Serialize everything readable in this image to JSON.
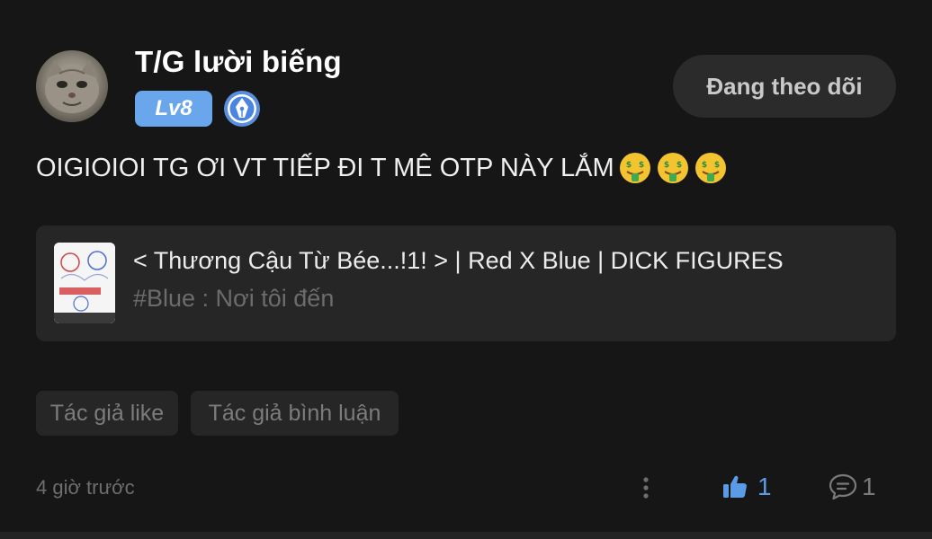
{
  "user": {
    "name": "T/G lười biếng",
    "level": "Lv8",
    "avatar_icon": "cat-avatar",
    "badge_icon": "pen-nib-badge-icon"
  },
  "follow_button": {
    "label": "Đang theo dõi"
  },
  "comment": {
    "text": "OIGIOIOI TG ƠI VT TIẾP ĐI T MÊ OTP NÀY LẮM",
    "emoji": [
      "money-mouth-face",
      "money-mouth-face",
      "money-mouth-face"
    ]
  },
  "story": {
    "title": "< Thương Cậu Từ Bée...!1! > | Red X Blue | DICK FIGURES",
    "chapter": "#Blue : Nơi tôi đến",
    "cover_icon": "story-cover-thumbnail"
  },
  "tags": [
    "Tác giả like",
    "Tác giả bình luận"
  ],
  "footer": {
    "time": "4 giờ trước",
    "likes": "1",
    "comments": "1",
    "more_icon": "more-vertical-icon",
    "like_icon": "thumbs-up-icon",
    "comment_icon": "comment-bubble-icon"
  },
  "colors": {
    "background": "#161616",
    "card": "#262626",
    "accent_blue": "#5b9be6",
    "level_badge": "#6aa6ec"
  }
}
